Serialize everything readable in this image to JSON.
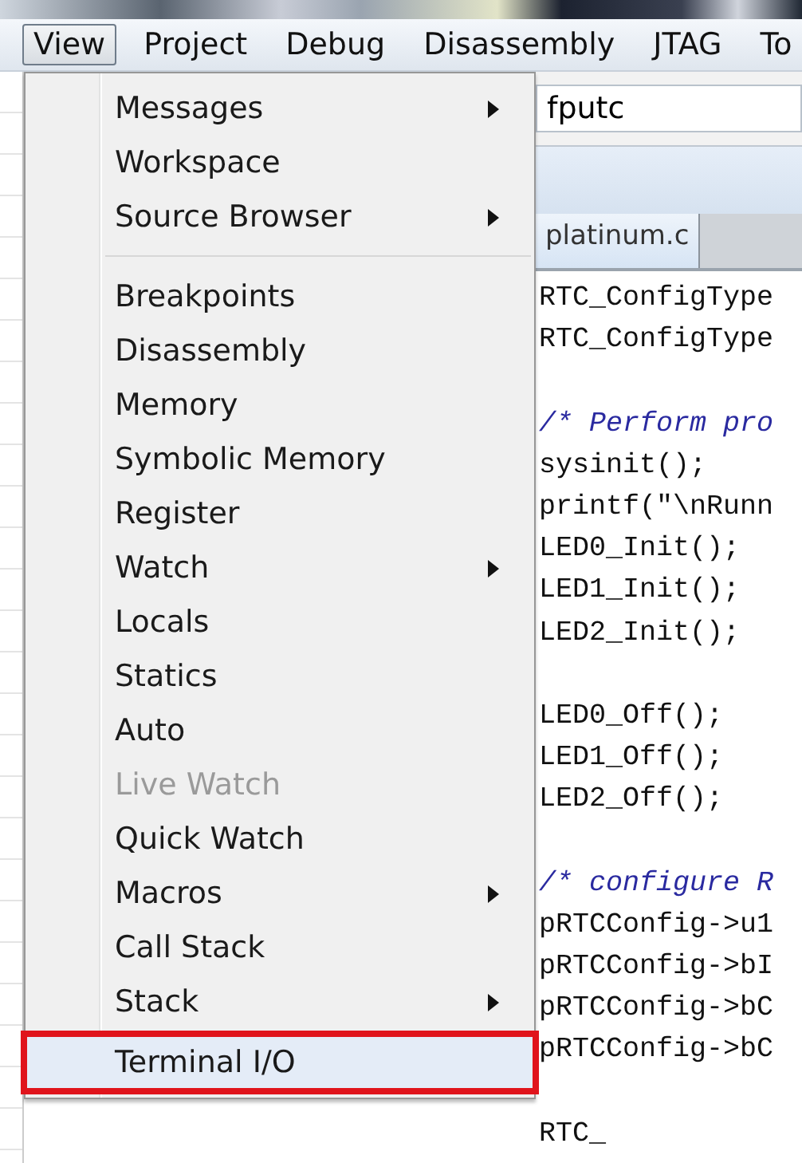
{
  "menu_bar": [
    {
      "label": "View",
      "selected": true
    },
    {
      "label": "Project",
      "selected": false
    },
    {
      "label": "Debug",
      "selected": false
    },
    {
      "label": "Disassembly",
      "selected": false
    },
    {
      "label": "JTAG",
      "selected": false
    },
    {
      "label": "To",
      "selected": false
    }
  ],
  "toolbar": {
    "search_value": "fputc"
  },
  "editor_tabs": [
    {
      "label": "platinum.c",
      "selected": true
    }
  ],
  "code_lines": [
    {
      "kind": "code",
      "text": "RTC_ConfigType"
    },
    {
      "kind": "code",
      "text": "RTC_ConfigType"
    },
    {
      "kind": "blank"
    },
    {
      "kind": "comment",
      "text": "/* Perform pro"
    },
    {
      "kind": "code",
      "text": "sysinit();"
    },
    {
      "kind": "code",
      "text": "printf(\"\\nRunn"
    },
    {
      "kind": "code",
      "text": "LED0_Init();"
    },
    {
      "kind": "code",
      "text": "LED1_Init();"
    },
    {
      "kind": "code",
      "text": "LED2_Init();"
    },
    {
      "kind": "blank"
    },
    {
      "kind": "code",
      "text": "LED0_Off();"
    },
    {
      "kind": "code",
      "text": "LED1_Off();"
    },
    {
      "kind": "code",
      "text": "LED2_Off();"
    },
    {
      "kind": "blank"
    },
    {
      "kind": "comment",
      "text": "/* configure R"
    },
    {
      "kind": "code",
      "text": "pRTCConfig->u1"
    },
    {
      "kind": "code",
      "text": "pRTCConfig->bI"
    },
    {
      "kind": "code",
      "text": "pRTCConfig->bC"
    },
    {
      "kind": "code",
      "text": "pRTCConfig->bC"
    },
    {
      "kind": "blank"
    },
    {
      "kind": "code",
      "text": "RTC_"
    }
  ],
  "view_menu": [
    {
      "kind": "item",
      "label": "Messages",
      "submenu": true,
      "disabled": false,
      "highlighted": false
    },
    {
      "kind": "item",
      "label": "Workspace",
      "submenu": false,
      "disabled": false,
      "highlighted": false
    },
    {
      "kind": "item",
      "label": "Source Browser",
      "submenu": true,
      "disabled": false,
      "highlighted": false
    },
    {
      "kind": "separator"
    },
    {
      "kind": "item",
      "label": "Breakpoints",
      "submenu": false,
      "disabled": false,
      "highlighted": false
    },
    {
      "kind": "item",
      "label": "Disassembly",
      "submenu": false,
      "disabled": false,
      "highlighted": false
    },
    {
      "kind": "item",
      "label": "Memory",
      "submenu": false,
      "disabled": false,
      "highlighted": false
    },
    {
      "kind": "item",
      "label": "Symbolic Memory",
      "submenu": false,
      "disabled": false,
      "highlighted": false
    },
    {
      "kind": "item",
      "label": "Register",
      "submenu": false,
      "disabled": false,
      "highlighted": false
    },
    {
      "kind": "item",
      "label": "Watch",
      "submenu": true,
      "disabled": false,
      "highlighted": false
    },
    {
      "kind": "item",
      "label": "Locals",
      "submenu": false,
      "disabled": false,
      "highlighted": false
    },
    {
      "kind": "item",
      "label": "Statics",
      "submenu": false,
      "disabled": false,
      "highlighted": false
    },
    {
      "kind": "item",
      "label": "Auto",
      "submenu": false,
      "disabled": false,
      "highlighted": false
    },
    {
      "kind": "item",
      "label": "Live Watch",
      "submenu": false,
      "disabled": true,
      "highlighted": false
    },
    {
      "kind": "item",
      "label": "Quick Watch",
      "submenu": false,
      "disabled": false,
      "highlighted": false
    },
    {
      "kind": "item",
      "label": "Macros",
      "submenu": true,
      "disabled": false,
      "highlighted": false
    },
    {
      "kind": "item",
      "label": "Call Stack",
      "submenu": false,
      "disabled": false,
      "highlighted": false
    },
    {
      "kind": "item",
      "label": "Stack",
      "submenu": true,
      "disabled": false,
      "highlighted": false
    },
    {
      "kind": "item",
      "label": "Terminal I/O",
      "submenu": false,
      "disabled": false,
      "highlighted": true
    }
  ]
}
